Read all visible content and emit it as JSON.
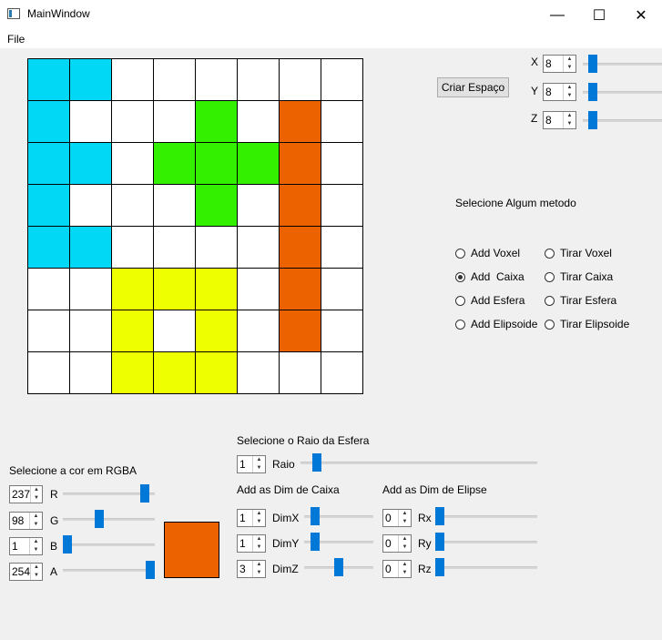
{
  "window": {
    "title": "MainWindow",
    "minimize_glyph": "—",
    "maximize_glyph": "☐",
    "close_glyph": "✕"
  },
  "menu": {
    "file": "File"
  },
  "colors": {
    "cyan": "#00d8f6",
    "green": "#33f000",
    "orange": "#ed6200",
    "yellow": "#eeff00",
    "white": "#ffffff"
  },
  "grid": [
    [
      "cyan",
      "cyan",
      "white",
      "white",
      "white",
      "white",
      "white",
      "white"
    ],
    [
      "cyan",
      "white",
      "white",
      "white",
      "green",
      "white",
      "orange",
      "white"
    ],
    [
      "cyan",
      "cyan",
      "white",
      "green",
      "green",
      "green",
      "orange",
      "white"
    ],
    [
      "cyan",
      "white",
      "white",
      "white",
      "green",
      "white",
      "orange",
      "white"
    ],
    [
      "cyan",
      "cyan",
      "white",
      "white",
      "white",
      "white",
      "orange",
      "white"
    ],
    [
      "white",
      "white",
      "yellow",
      "yellow",
      "yellow",
      "white",
      "orange",
      "white"
    ],
    [
      "white",
      "white",
      "yellow",
      "white",
      "yellow",
      "white",
      "orange",
      "white"
    ],
    [
      "white",
      "white",
      "yellow",
      "yellow",
      "yellow",
      "white",
      "white",
      "white"
    ]
  ],
  "space": {
    "create_button": "Criar Espaço",
    "x": {
      "label": "X",
      "value": "8",
      "slider": 0.08
    },
    "y": {
      "label": "Y",
      "value": "8",
      "slider": 0.08
    },
    "z": {
      "label": "Z",
      "value": "8",
      "slider": 0.08
    }
  },
  "methods": {
    "heading": "Selecione Algum metodo",
    "options": [
      {
        "label": "Add Voxel",
        "checked": false
      },
      {
        "label": "Tirar Voxel",
        "checked": false
      },
      {
        "label": "Add  Caixa",
        "checked": true
      },
      {
        "label": "Tirar Caixa",
        "checked": false
      },
      {
        "label": "Add Esfera",
        "checked": false
      },
      {
        "label": "Tirar Esfera",
        "checked": false
      },
      {
        "label": "Add Elipsoide",
        "checked": false
      },
      {
        "label": "Tirar Elipsoide",
        "checked": false
      }
    ]
  },
  "rgba": {
    "heading": "Selecione a cor em RGBA",
    "r": {
      "label": "R",
      "value": "237",
      "slider": 0.93
    },
    "g": {
      "label": "G",
      "value": "98",
      "slider": 0.38
    },
    "b": {
      "label": "B",
      "value": "1",
      "slider": 0.0
    },
    "a": {
      "label": "A",
      "value": "254",
      "slider": 1.0
    },
    "preview_color": "#ed6200"
  },
  "sphere": {
    "heading": "Selecione o Raio da Esfera",
    "raio": {
      "label": "Raio",
      "value": "1",
      "slider": 0.05
    }
  },
  "box": {
    "heading": "Add as Dim de Caixa",
    "dimx": {
      "label": "DimX",
      "value": "1",
      "slider": 0.1
    },
    "dimy": {
      "label": "DimY",
      "value": "1",
      "slider": 0.1
    },
    "dimz": {
      "label": "DimZ",
      "value": "3",
      "slider": 0.5
    }
  },
  "ellipse": {
    "heading": "Add as Dim de Elipse",
    "rx": {
      "label": "Rx",
      "value": "0",
      "slider": 0.0
    },
    "ry": {
      "label": "Ry",
      "value": "0",
      "slider": 0.0
    },
    "rz": {
      "label": "Rz",
      "value": "0",
      "slider": 0.0
    }
  }
}
